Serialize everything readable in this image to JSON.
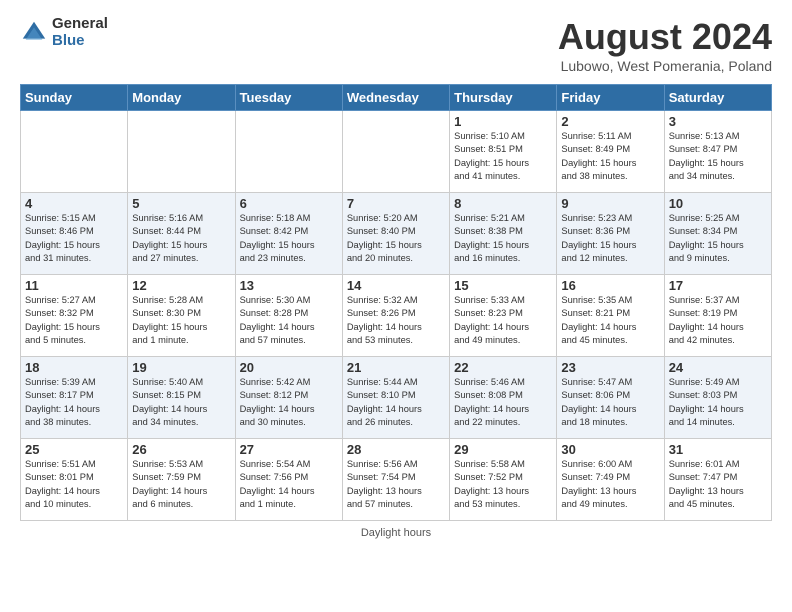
{
  "header": {
    "logo_general": "General",
    "logo_blue": "Blue",
    "title": "August 2024",
    "subtitle": "Lubowo, West Pomerania, Poland"
  },
  "days_of_week": [
    "Sunday",
    "Monday",
    "Tuesday",
    "Wednesday",
    "Thursday",
    "Friday",
    "Saturday"
  ],
  "weeks": [
    [
      {
        "day": "",
        "info": ""
      },
      {
        "day": "",
        "info": ""
      },
      {
        "day": "",
        "info": ""
      },
      {
        "day": "",
        "info": ""
      },
      {
        "day": "1",
        "info": "Sunrise: 5:10 AM\nSunset: 8:51 PM\nDaylight: 15 hours\nand 41 minutes."
      },
      {
        "day": "2",
        "info": "Sunrise: 5:11 AM\nSunset: 8:49 PM\nDaylight: 15 hours\nand 38 minutes."
      },
      {
        "day": "3",
        "info": "Sunrise: 5:13 AM\nSunset: 8:47 PM\nDaylight: 15 hours\nand 34 minutes."
      }
    ],
    [
      {
        "day": "4",
        "info": "Sunrise: 5:15 AM\nSunset: 8:46 PM\nDaylight: 15 hours\nand 31 minutes."
      },
      {
        "day": "5",
        "info": "Sunrise: 5:16 AM\nSunset: 8:44 PM\nDaylight: 15 hours\nand 27 minutes."
      },
      {
        "day": "6",
        "info": "Sunrise: 5:18 AM\nSunset: 8:42 PM\nDaylight: 15 hours\nand 23 minutes."
      },
      {
        "day": "7",
        "info": "Sunrise: 5:20 AM\nSunset: 8:40 PM\nDaylight: 15 hours\nand 20 minutes."
      },
      {
        "day": "8",
        "info": "Sunrise: 5:21 AM\nSunset: 8:38 PM\nDaylight: 15 hours\nand 16 minutes."
      },
      {
        "day": "9",
        "info": "Sunrise: 5:23 AM\nSunset: 8:36 PM\nDaylight: 15 hours\nand 12 minutes."
      },
      {
        "day": "10",
        "info": "Sunrise: 5:25 AM\nSunset: 8:34 PM\nDaylight: 15 hours\nand 9 minutes."
      }
    ],
    [
      {
        "day": "11",
        "info": "Sunrise: 5:27 AM\nSunset: 8:32 PM\nDaylight: 15 hours\nand 5 minutes."
      },
      {
        "day": "12",
        "info": "Sunrise: 5:28 AM\nSunset: 8:30 PM\nDaylight: 15 hours\nand 1 minute."
      },
      {
        "day": "13",
        "info": "Sunrise: 5:30 AM\nSunset: 8:28 PM\nDaylight: 14 hours\nand 57 minutes."
      },
      {
        "day": "14",
        "info": "Sunrise: 5:32 AM\nSunset: 8:26 PM\nDaylight: 14 hours\nand 53 minutes."
      },
      {
        "day": "15",
        "info": "Sunrise: 5:33 AM\nSunset: 8:23 PM\nDaylight: 14 hours\nand 49 minutes."
      },
      {
        "day": "16",
        "info": "Sunrise: 5:35 AM\nSunset: 8:21 PM\nDaylight: 14 hours\nand 45 minutes."
      },
      {
        "day": "17",
        "info": "Sunrise: 5:37 AM\nSunset: 8:19 PM\nDaylight: 14 hours\nand 42 minutes."
      }
    ],
    [
      {
        "day": "18",
        "info": "Sunrise: 5:39 AM\nSunset: 8:17 PM\nDaylight: 14 hours\nand 38 minutes."
      },
      {
        "day": "19",
        "info": "Sunrise: 5:40 AM\nSunset: 8:15 PM\nDaylight: 14 hours\nand 34 minutes."
      },
      {
        "day": "20",
        "info": "Sunrise: 5:42 AM\nSunset: 8:12 PM\nDaylight: 14 hours\nand 30 minutes."
      },
      {
        "day": "21",
        "info": "Sunrise: 5:44 AM\nSunset: 8:10 PM\nDaylight: 14 hours\nand 26 minutes."
      },
      {
        "day": "22",
        "info": "Sunrise: 5:46 AM\nSunset: 8:08 PM\nDaylight: 14 hours\nand 22 minutes."
      },
      {
        "day": "23",
        "info": "Sunrise: 5:47 AM\nSunset: 8:06 PM\nDaylight: 14 hours\nand 18 minutes."
      },
      {
        "day": "24",
        "info": "Sunrise: 5:49 AM\nSunset: 8:03 PM\nDaylight: 14 hours\nand 14 minutes."
      }
    ],
    [
      {
        "day": "25",
        "info": "Sunrise: 5:51 AM\nSunset: 8:01 PM\nDaylight: 14 hours\nand 10 minutes."
      },
      {
        "day": "26",
        "info": "Sunrise: 5:53 AM\nSunset: 7:59 PM\nDaylight: 14 hours\nand 6 minutes."
      },
      {
        "day": "27",
        "info": "Sunrise: 5:54 AM\nSunset: 7:56 PM\nDaylight: 14 hours\nand 1 minute."
      },
      {
        "day": "28",
        "info": "Sunrise: 5:56 AM\nSunset: 7:54 PM\nDaylight: 13 hours\nand 57 minutes."
      },
      {
        "day": "29",
        "info": "Sunrise: 5:58 AM\nSunset: 7:52 PM\nDaylight: 13 hours\nand 53 minutes."
      },
      {
        "day": "30",
        "info": "Sunrise: 6:00 AM\nSunset: 7:49 PM\nDaylight: 13 hours\nand 49 minutes."
      },
      {
        "day": "31",
        "info": "Sunrise: 6:01 AM\nSunset: 7:47 PM\nDaylight: 13 hours\nand 45 minutes."
      }
    ]
  ],
  "footer": {
    "daylight_label": "Daylight hours"
  }
}
